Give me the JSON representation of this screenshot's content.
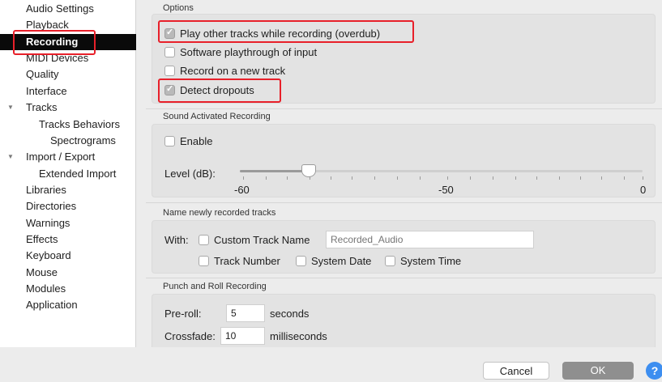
{
  "sidebar": {
    "items": [
      {
        "label": "Audio Settings"
      },
      {
        "label": "Playback"
      },
      {
        "label": "Recording",
        "selected": true
      },
      {
        "label": "MIDI Devices"
      },
      {
        "label": "Quality"
      },
      {
        "label": "Interface"
      },
      {
        "label": "Tracks",
        "expanded": true
      },
      {
        "label": "Tracks Behaviors"
      },
      {
        "label": "Spectrograms"
      },
      {
        "label": "Import / Export",
        "expanded": true
      },
      {
        "label": "Extended Import"
      },
      {
        "label": "Libraries"
      },
      {
        "label": "Directories"
      },
      {
        "label": "Warnings"
      },
      {
        "label": "Effects"
      },
      {
        "label": "Keyboard"
      },
      {
        "label": "Mouse"
      },
      {
        "label": "Modules"
      },
      {
        "label": "Application"
      }
    ]
  },
  "options": {
    "title": "Options",
    "overdub": {
      "label": "Play other tracks while recording (overdub)",
      "checked": true
    },
    "playthrough": {
      "label": "Software playthrough of input",
      "checked": false
    },
    "new_track": {
      "label": "Record on a new track",
      "checked": false
    },
    "dropouts": {
      "label": "Detect dropouts",
      "checked": true
    }
  },
  "sound_activated": {
    "title": "Sound Activated Recording",
    "enable": {
      "label": "Enable",
      "checked": false
    },
    "level_label": "Level (dB):",
    "level_value": -50,
    "tick_labels": [
      "-60",
      "-50",
      "0"
    ]
  },
  "naming": {
    "title": "Name newly recorded tracks",
    "with_label": "With:",
    "custom_name": {
      "label": "Custom Track Name",
      "checked": false
    },
    "custom_name_placeholder": "Recorded_Audio",
    "track_number": {
      "label": "Track Number",
      "checked": false
    },
    "system_date": {
      "label": "System Date",
      "checked": false
    },
    "system_time": {
      "label": "System Time",
      "checked": false
    }
  },
  "punch_roll": {
    "title": "Punch and Roll Recording",
    "preroll_label": "Pre-roll:",
    "preroll_value": "5",
    "preroll_unit": "seconds",
    "crossfade_label": "Crossfade:",
    "crossfade_value": "10",
    "crossfade_unit": "milliseconds"
  },
  "footer": {
    "cancel_label": "Cancel",
    "ok_label": "OK",
    "help_label": "?"
  },
  "colors": {
    "highlight": "#e8202a",
    "selected_bg": "#0a0a0a",
    "help_blue": "#3d8ef0"
  }
}
